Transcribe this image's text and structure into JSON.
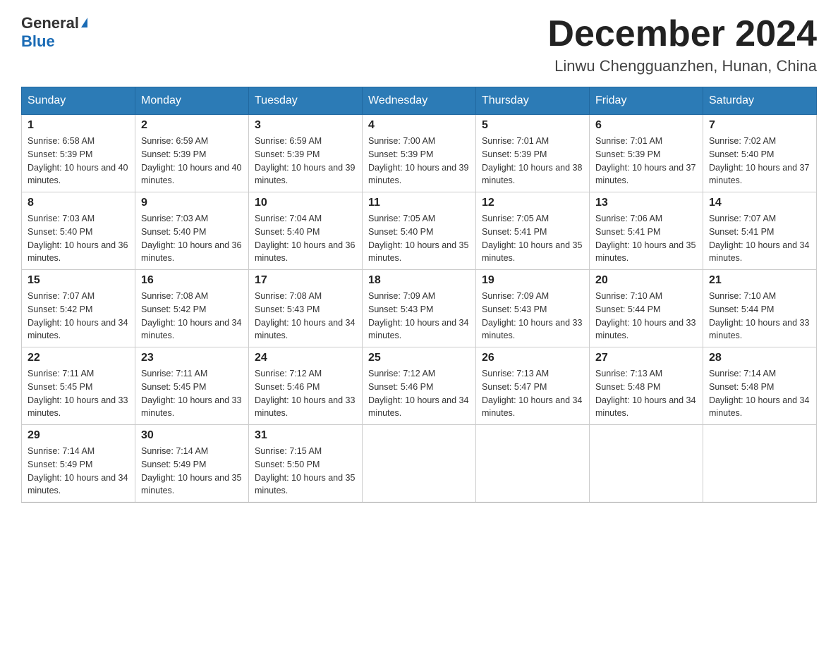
{
  "logo": {
    "text_general": "General",
    "text_blue": "Blue"
  },
  "title": "December 2024",
  "subtitle": "Linwu Chengguanzhen, Hunan, China",
  "weekdays": [
    "Sunday",
    "Monday",
    "Tuesday",
    "Wednesday",
    "Thursday",
    "Friday",
    "Saturday"
  ],
  "weeks": [
    [
      {
        "day": "1",
        "sunrise": "6:58 AM",
        "sunset": "5:39 PM",
        "daylight": "10 hours and 40 minutes."
      },
      {
        "day": "2",
        "sunrise": "6:59 AM",
        "sunset": "5:39 PM",
        "daylight": "10 hours and 40 minutes."
      },
      {
        "day": "3",
        "sunrise": "6:59 AM",
        "sunset": "5:39 PM",
        "daylight": "10 hours and 39 minutes."
      },
      {
        "day": "4",
        "sunrise": "7:00 AM",
        "sunset": "5:39 PM",
        "daylight": "10 hours and 39 minutes."
      },
      {
        "day": "5",
        "sunrise": "7:01 AM",
        "sunset": "5:39 PM",
        "daylight": "10 hours and 38 minutes."
      },
      {
        "day": "6",
        "sunrise": "7:01 AM",
        "sunset": "5:39 PM",
        "daylight": "10 hours and 37 minutes."
      },
      {
        "day": "7",
        "sunrise": "7:02 AM",
        "sunset": "5:40 PM",
        "daylight": "10 hours and 37 minutes."
      }
    ],
    [
      {
        "day": "8",
        "sunrise": "7:03 AM",
        "sunset": "5:40 PM",
        "daylight": "10 hours and 36 minutes."
      },
      {
        "day": "9",
        "sunrise": "7:03 AM",
        "sunset": "5:40 PM",
        "daylight": "10 hours and 36 minutes."
      },
      {
        "day": "10",
        "sunrise": "7:04 AM",
        "sunset": "5:40 PM",
        "daylight": "10 hours and 36 minutes."
      },
      {
        "day": "11",
        "sunrise": "7:05 AM",
        "sunset": "5:40 PM",
        "daylight": "10 hours and 35 minutes."
      },
      {
        "day": "12",
        "sunrise": "7:05 AM",
        "sunset": "5:41 PM",
        "daylight": "10 hours and 35 minutes."
      },
      {
        "day": "13",
        "sunrise": "7:06 AM",
        "sunset": "5:41 PM",
        "daylight": "10 hours and 35 minutes."
      },
      {
        "day": "14",
        "sunrise": "7:07 AM",
        "sunset": "5:41 PM",
        "daylight": "10 hours and 34 minutes."
      }
    ],
    [
      {
        "day": "15",
        "sunrise": "7:07 AM",
        "sunset": "5:42 PM",
        "daylight": "10 hours and 34 minutes."
      },
      {
        "day": "16",
        "sunrise": "7:08 AM",
        "sunset": "5:42 PM",
        "daylight": "10 hours and 34 minutes."
      },
      {
        "day": "17",
        "sunrise": "7:08 AM",
        "sunset": "5:43 PM",
        "daylight": "10 hours and 34 minutes."
      },
      {
        "day": "18",
        "sunrise": "7:09 AM",
        "sunset": "5:43 PM",
        "daylight": "10 hours and 34 minutes."
      },
      {
        "day": "19",
        "sunrise": "7:09 AM",
        "sunset": "5:43 PM",
        "daylight": "10 hours and 33 minutes."
      },
      {
        "day": "20",
        "sunrise": "7:10 AM",
        "sunset": "5:44 PM",
        "daylight": "10 hours and 33 minutes."
      },
      {
        "day": "21",
        "sunrise": "7:10 AM",
        "sunset": "5:44 PM",
        "daylight": "10 hours and 33 minutes."
      }
    ],
    [
      {
        "day": "22",
        "sunrise": "7:11 AM",
        "sunset": "5:45 PM",
        "daylight": "10 hours and 33 minutes."
      },
      {
        "day": "23",
        "sunrise": "7:11 AM",
        "sunset": "5:45 PM",
        "daylight": "10 hours and 33 minutes."
      },
      {
        "day": "24",
        "sunrise": "7:12 AM",
        "sunset": "5:46 PM",
        "daylight": "10 hours and 33 minutes."
      },
      {
        "day": "25",
        "sunrise": "7:12 AM",
        "sunset": "5:46 PM",
        "daylight": "10 hours and 34 minutes."
      },
      {
        "day": "26",
        "sunrise": "7:13 AM",
        "sunset": "5:47 PM",
        "daylight": "10 hours and 34 minutes."
      },
      {
        "day": "27",
        "sunrise": "7:13 AM",
        "sunset": "5:48 PM",
        "daylight": "10 hours and 34 minutes."
      },
      {
        "day": "28",
        "sunrise": "7:14 AM",
        "sunset": "5:48 PM",
        "daylight": "10 hours and 34 minutes."
      }
    ],
    [
      {
        "day": "29",
        "sunrise": "7:14 AM",
        "sunset": "5:49 PM",
        "daylight": "10 hours and 34 minutes."
      },
      {
        "day": "30",
        "sunrise": "7:14 AM",
        "sunset": "5:49 PM",
        "daylight": "10 hours and 35 minutes."
      },
      {
        "day": "31",
        "sunrise": "7:15 AM",
        "sunset": "5:50 PM",
        "daylight": "10 hours and 35 minutes."
      },
      null,
      null,
      null,
      null
    ]
  ]
}
